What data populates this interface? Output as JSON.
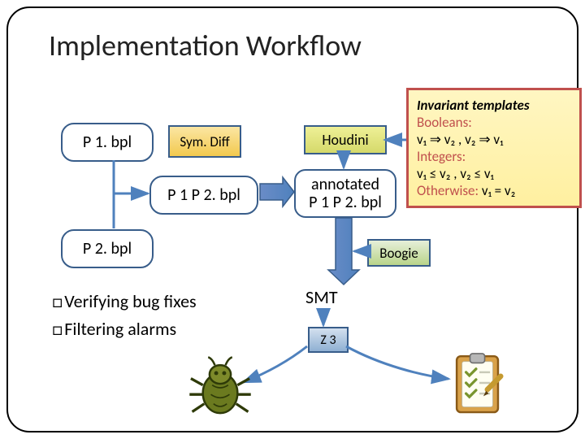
{
  "title": "Implementation Workflow",
  "nodes": {
    "p1": "P 1. bpl",
    "p2": "P 2. bpl",
    "symdiff": "Sym. Diff",
    "p1p2": "P 1 P 2. bpl",
    "houdini": "Houdini",
    "annotated_line1": "annotated",
    "annotated_line2": "P 1 P 2. bpl",
    "boogie": "Boogie",
    "smt": "SMT",
    "z3": "Z 3"
  },
  "templates": {
    "header": "Invariant templates",
    "bool_label": "Booleans:",
    "bool_expr": "v₁ ⇒ v₂ , v₂ ⇒ v₁",
    "int_label": "Integers:",
    "int_expr": "v₁ ≤ v₂ , v₂ ≤ v₁",
    "other_label": "Otherwise:",
    "other_expr": "v₁ = v₂"
  },
  "bullets": {
    "b1": "Verifying bug fixes",
    "b2": "Filtering alarms"
  }
}
